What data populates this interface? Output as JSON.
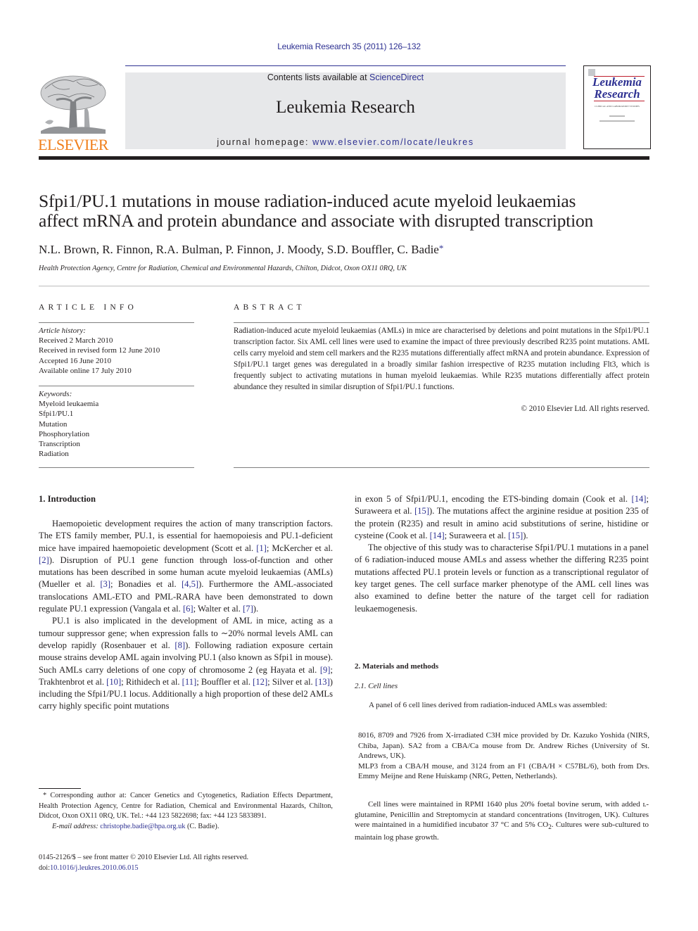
{
  "header": {
    "journal_ref": "Leukemia Research 35 (2011) 126–132",
    "contents_prefix": "Contents lists available at ",
    "contents_link": "ScienceDirect",
    "journal_title": "Leukemia Research",
    "homepage_prefix": "journal homepage: ",
    "homepage_link": "www.elsevier.com/locate/leukres",
    "publisher_logo_text": "ELSEVIER",
    "cover_title_line1": "Leukemia",
    "cover_title_line2": "Research",
    "cover_subtitle": "CLINICAL AND LABORATORY STUDIES"
  },
  "article": {
    "title_line1": "Sfpi1/PU.1 mutations in mouse radiation-induced acute myeloid leukaemias",
    "title_line2": "affect mRNA and protein abundance and associate with disrupted transcription",
    "authors": "N.L. Brown, R. Finnon, R.A. Bulman, P. Finnon, J. Moody, S.D. Bouffler, C. Badie",
    "corresponding_marker": "*",
    "affiliation": "Health Protection Agency, Centre for Radiation, Chemical and Environmental Hazards, Chilton, Didcot, Oxon OX11 0RQ, UK"
  },
  "article_info": {
    "heading": "ARTICLE INFO",
    "history_label": "Article history:",
    "history": [
      "Received 2 March 2010",
      "Received in revised form 12 June 2010",
      "Accepted 16 June 2010",
      "Available online 17 July 2010"
    ],
    "keywords_label": "Keywords:",
    "keywords": [
      "Myeloid leukaemia",
      "Sfpi1/PU.1",
      "Mutation",
      "Phosphorylation",
      "Transcription",
      "Radiation"
    ]
  },
  "abstract": {
    "heading": "ABSTRACT",
    "text": "Radiation-induced acute myeloid leukaemias (AMLs) in mice are characterised by deletions and point mutations in the Sfpi1/PU.1 transcription factor. Six AML cell lines were used to examine the impact of three previously described R235 point mutations. AML cells carry myeloid and stem cell markers and the R235 mutations differentially affect mRNA and protein abundance. Expression of Sfpi1/PU.1 target genes was deregulated in a broadly similar fashion irrespective of R235 mutation including Flt3, which is frequently subject to activating mutations in human myeloid leukaemias. While R235 mutations differentially affect protein abundance they resulted in similar disruption of Sfpi1/PU.1 functions.",
    "copyright": "© 2010 Elsevier Ltd. All rights reserved."
  },
  "introduction": {
    "heading": "1.  Introduction",
    "p1": [
      {
        "t": "Haemopoietic development requires the action of many transcription factors. The ETS family member, PU.1, is essential for haemopoiesis and PU.1-deficient mice have impaired haemopoietic development (Scott et al. "
      },
      {
        "c": "[1]"
      },
      {
        "t": "; McKercher et al. "
      },
      {
        "c": "[2]"
      },
      {
        "t": "). Disruption of PU.1 gene function through loss-of-function and other mutations has been described in some human acute myeloid leukaemias (AMLs) (Mueller et al. "
      },
      {
        "c": "[3]"
      },
      {
        "t": "; Bonadies et al. "
      },
      {
        "c": "[4,5]"
      },
      {
        "t": "). Furthermore the AML-associated translocations AML-ETO and PML-RARA have been demonstrated to down regulate PU.1 expression (Vangala et al. "
      },
      {
        "c": "[6]"
      },
      {
        "t": "; Walter et al. "
      },
      {
        "c": "[7]"
      },
      {
        "t": ")."
      }
    ],
    "p2": [
      {
        "t": "PU.1 is also implicated in the development of AML in mice, acting as a tumour suppressor gene; when expression falls to ∼20% normal levels AML can develop rapidly (Rosenbauer et al. "
      },
      {
        "c": "[8]"
      },
      {
        "t": "). Following radiation exposure certain mouse strains develop AML again involving PU.1 (also known as Sfpi1 in mouse). Such AMLs carry deletions of one copy of chromosome 2 (eg Hayata et al. "
      },
      {
        "c": "[9]"
      },
      {
        "t": "; Trakhtenbrot et al. "
      },
      {
        "c": "[10]"
      },
      {
        "t": "; Rithidech et al. "
      },
      {
        "c": "[11]"
      },
      {
        "t": "; Bouffler et al. "
      },
      {
        "c": "[12]"
      },
      {
        "t": "; Silver et al. "
      },
      {
        "c": "[13]"
      },
      {
        "t": ") including the Sfpi1/PU.1 locus. Additionally a high proportion of these del2 AMLs carry highly specific point mutations"
      }
    ],
    "p3": [
      {
        "t": "in exon 5 of Sfpi1/PU.1, encoding the ETS-binding domain (Cook et al. "
      },
      {
        "c": "[14]"
      },
      {
        "t": "; Suraweera et al. "
      },
      {
        "c": "[15]"
      },
      {
        "t": "). The mutations affect the arginine residue at position 235 of the protein (R235) and result in amino acid substitutions of serine, histidine or cysteine (Cook et al. "
      },
      {
        "c": "[14]"
      },
      {
        "t": "; Suraweera et al. "
      },
      {
        "c": "[15]"
      },
      {
        "t": ")."
      }
    ],
    "p4": "The objective of this study was to characterise Sfpi1/PU.1 mutations in a panel of 6 radiation-induced mouse AMLs and assess whether the differing R235 point mutations affected PU.1 protein levels or function as a transcriptional regulator of key target genes. The cell surface marker phenotype of the AML cell lines was also examined to define better the nature of the target cell for radiation leukaemogenesis."
  },
  "methods": {
    "heading": "2.  Materials and methods",
    "subheading": "2.1.   Cell lines",
    "panel_intro": "A panel of 6 cell lines derived from radiation-induced AMLs was assembled:",
    "cell_lines": [
      "8016, 8709 and 7926 from X-irradiated C3H mice provided by Dr. Kazuko Yoshida (NIRS, Chiba, Japan). SA2 from a CBA/Ca mouse from Dr. Andrew Riches (University of St. Andrews, UK).",
      "MLP3 from a CBA/H mouse, and 3124 from an F1 (CBA/H × C57BL/6), both from Drs. Emmy Meijne and Rene Huiskamp (NRG, Petten, Netherlands)."
    ],
    "culture_text_a": "Cell lines were maintained in RPMI 1640 plus 20% foetal bovine serum, with added ʟ-glutamine, Penicillin and Streptomycin at standard concentrations (Invitrogen, UK). Cultures were maintained in a humidified incubator 37 °C and 5% CO",
    "culture_sub": "2",
    "culture_text_b": ". Cultures were sub-cultured to maintain log phase growth."
  },
  "footnotes": {
    "corresponding": "* Corresponding author at: Cancer Genetics and Cytogenetics, Radiation Effects Department, Health Protection Agency, Centre for Radiation, Chemical and Environmental Hazards, Chilton, Didcot, Oxon OX11 0RQ, UK. Tel.: +44 123 5822698; fax: +44 123 5833891.",
    "email_label": "E-mail address: ",
    "email": "christophe.badie@hpa.org.uk",
    "email_suffix": " (C. Badie).",
    "front_matter": "0145-2126/$ – see front matter © 2010 Elsevier Ltd. All rights reserved.",
    "doi_prefix": "doi:",
    "doi": "10.1016/j.leukres.2010.06.015"
  },
  "colors": {
    "link": "#2e3192",
    "elsevier_orange": "#f07f1b",
    "masthead_bg": "#e7e8ea",
    "text": "#231f20"
  }
}
